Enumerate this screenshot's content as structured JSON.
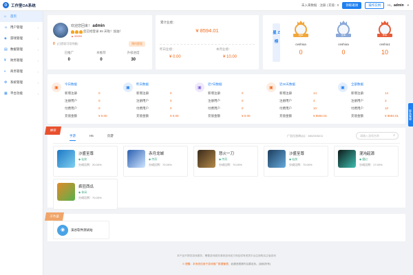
{
  "app": {
    "title": "工作室OA系统",
    "logo_letter": "O"
  },
  "topbar": {
    "notice": "未入来数据 · 注册 | 充值 : 0",
    "btn_primary": "领取邀请",
    "btn_secondary": "操作实例",
    "greeting": "Hi，",
    "username": "admin"
  },
  "sidebar": {
    "items": [
      {
        "label": "首页",
        "icon": "home-icon",
        "glyph": "⌂",
        "active": true
      },
      {
        "label": "用户管理",
        "icon": "user-icon",
        "glyph": "☺"
      },
      {
        "label": "游戏管理",
        "icon": "game-icon",
        "glyph": "◈"
      },
      {
        "label": "数据管理",
        "icon": "data-icon",
        "glyph": "▤"
      },
      {
        "label": "财务管理",
        "icon": "finance-icon",
        "glyph": "¥"
      },
      {
        "label": "商务管理",
        "icon": "business-icon",
        "glyph": "◐"
      },
      {
        "label": "系统管理",
        "icon": "gear-icon",
        "glyph": "⚙"
      },
      {
        "label": "平台功能",
        "icon": "platform-icon",
        "glyph": "▦"
      }
    ]
  },
  "welcome": {
    "hello": "欢迎您回来！",
    "username": "admin",
    "streak_text": "您已经登录 99 天啦！加油！",
    "score_link": "99999",
    "zero_value": "0",
    "zero_hint": "(已提现可用余额)",
    "apply_button": "预约提现"
  },
  "stats": [
    {
      "label": "已推广",
      "value": "0"
    },
    {
      "label": "本推荐",
      "value": "0"
    },
    {
      "label": "升级进度",
      "value": "30"
    }
  ],
  "performance": {
    "title": "累计业绩：",
    "main": "¥ 8594.01",
    "yesterday_label": "昨日业绩：",
    "yesterday_value": "¥ 0.00",
    "month_label": "本月业绩：",
    "month_value": "¥ 10.00"
  },
  "ranking": {
    "strip": "星 Z 榜",
    "medals": [
      {
        "name": "ceshioa",
        "value": "0",
        "ribbon": "冠军",
        "color": "#f1a63a"
      },
      {
        "name": "ceshioa",
        "value": "0",
        "ribbon": "亚军",
        "color": "#8aa8d8"
      },
      {
        "name": "ceshio1",
        "value": "10",
        "ribbon": "季军",
        "color": "#e65c3a"
      }
    ]
  },
  "data_groups": [
    {
      "title": "今日数据",
      "icon": "calendar-icon",
      "glyph": "▣",
      "color": "#f26b1d",
      "bg": "#fdece1",
      "rows": [
        {
          "label": "新增注册",
          "value": "0"
        },
        {
          "label": "注册用户",
          "value": "0"
        },
        {
          "label": "付费用户",
          "value": "0"
        },
        {
          "label": "充值金额",
          "value": "¥ 0.00"
        }
      ]
    },
    {
      "title": "昨日数据",
      "icon": "calendar-icon",
      "glyph": "▣",
      "color": "#1e7ff0",
      "bg": "#e3eefd",
      "rows": [
        {
          "label": "新增注册",
          "value": "0"
        },
        {
          "label": "注册用户",
          "value": "0"
        },
        {
          "label": "付费用户",
          "value": "0"
        },
        {
          "label": "充值金额",
          "value": "¥ 0.00"
        }
      ]
    },
    {
      "title": "近7日数据",
      "icon": "calendar-icon",
      "glyph": "▣",
      "color": "#7b5fd9",
      "bg": "#efe9fc",
      "rows": [
        {
          "label": "新增注册",
          "value": "0"
        },
        {
          "label": "注册用户",
          "value": "0"
        },
        {
          "label": "付费用户",
          "value": "0"
        },
        {
          "label": "充值金额",
          "value": "¥ 0.00"
        }
      ]
    },
    {
      "title": "近30天数据",
      "icon": "calendar-icon",
      "glyph": "▣",
      "color": "#f26b1d",
      "bg": "#fdece1",
      "rows": [
        {
          "label": "新增注册",
          "value": "14"
        },
        {
          "label": "注册用户",
          "value": "3"
        },
        {
          "label": "付费用户",
          "value": "10"
        },
        {
          "label": "充值金额",
          "value": "¥ 8594.01"
        }
      ]
    },
    {
      "title": "全部数据",
      "icon": "calendar-icon",
      "glyph": "▣",
      "color": "#1e7ff0",
      "bg": "#e3eefd",
      "rows": [
        {
          "label": "新增注册",
          "value": "14"
        },
        {
          "label": "注册用户",
          "value": "3"
        },
        {
          "label": "付费用户",
          "value": "10"
        },
        {
          "label": "充值金额",
          "value": "¥ 8594.01"
        }
      ]
    }
  ],
  "games_section": {
    "ribbon": "推荐",
    "tabs": [
      "手游",
      "H5",
      "页游"
    ],
    "agent_qq": "广告位咨询QQ：3802305211",
    "search_placeholder": "请输入游戏名称",
    "games": [
      {
        "name": "沙盛至尊",
        "tag": "仙侠",
        "share": "分成比例：20.00%",
        "color1": "#1d78c5",
        "color2": "#7fd0f0"
      },
      {
        "name": "赤月龙城",
        "tag": "传奇",
        "share": "分成比例：70.00%",
        "color1": "#2a5fb0",
        "color2": "#cfe5ff"
      },
      {
        "name": "怒火一刀",
        "tag": "传奇",
        "share": "分成比例：70.00%",
        "color1": "#3a2a1a",
        "color2": "#b48a4a"
      },
      {
        "name": "沙盛至尊",
        "tag": "仙侠",
        "share": "分成比例：70.00%",
        "color1": "#1c3d5c",
        "color2": "#6ad"
      },
      {
        "name": "混沌起源",
        "tag": "魔幻",
        "share": "分成比例：17.00%",
        "color1": "#0e1a1a",
        "color2": "#3dbfb0"
      },
      {
        "name": "疯狂西瓜",
        "tag": "休闲",
        "share": "分成比例：70.00%",
        "color1": "#e08a2a",
        "color2": "#5ab04a"
      }
    ]
  },
  "studio_section": {
    "ribbon": "工作室",
    "name": "溪谷软件测试站",
    "logo_glyph": "◉"
  },
  "footer": {
    "line1": "本产品不提供游戏服务，需要游戏服务请到游戏官方网站或有资质平台注册购买正版游戏",
    "line2_warn": "⊙ 提醒：本系统仅用于游戏推广数据管理，",
    "line2_rest": "如遇违规操作后果自负。(版权所有)"
  },
  "float_tab": "联系客服"
}
